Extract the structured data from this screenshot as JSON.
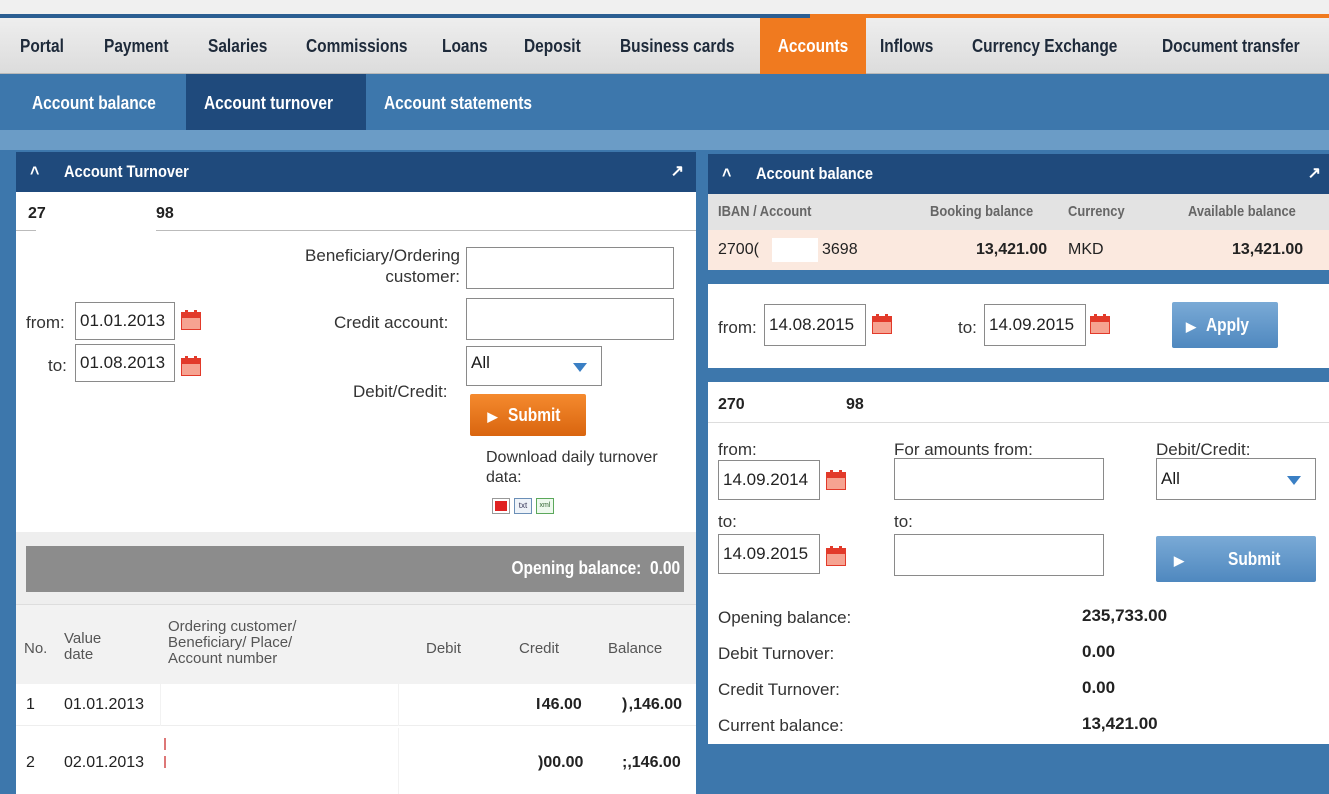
{
  "top_nav": {
    "items": [
      "Portal",
      "Payment",
      "Salaries",
      "Commissions",
      "Loans",
      "Deposit",
      "Business cards",
      "Accounts",
      "Inflows",
      "Currency Exchange",
      "Document transfer"
    ],
    "active": "Accounts"
  },
  "sub_nav": {
    "items": [
      "Account balance",
      "Account turnover",
      "Account statements"
    ],
    "active": "Account turnover"
  },
  "turnover_panel": {
    "title": "Account Turnover",
    "account_part1": "27",
    "account_part2": "98",
    "from_label": "from:",
    "from_value": "01.01.2013",
    "to_label": "to:",
    "to_value": "01.08.2013",
    "beneficiary_label_1": "Beneficiary/Ordering",
    "beneficiary_label_2": "customer:",
    "beneficiary_value": "",
    "credit_account_label": "Credit account:",
    "credit_account_value": "",
    "debit_credit_label": "Debit/Credit:",
    "debit_credit_value": "All",
    "submit_label": "Submit",
    "download_label_1": "Download daily turnover",
    "download_label_2": "data:",
    "download_icons": [
      "pdf-icon",
      "txt-icon",
      "xml-icon"
    ],
    "txt_text": "txt",
    "xml_text": "xml",
    "opening_balance_label": "Opening balance:",
    "opening_balance_value": "0.00",
    "table": {
      "headers": {
        "no": "No.",
        "value_date_1": "Value",
        "value_date_2": "date",
        "ordering_1": "Ordering customer/",
        "ordering_2": "Beneficiary/ Place/",
        "ordering_3": "Account number",
        "debit": "Debit",
        "credit": "Credit",
        "balance": "Balance"
      },
      "rows": [
        {
          "no": "1",
          "date": "01.01.2013",
          "credit": "І 46.00",
          "balance": ") ,146.00"
        },
        {
          "no": "2",
          "date": "02.01.2013",
          "credit": ")00.00",
          "balance": ";,146.00"
        }
      ]
    }
  },
  "balance_panel": {
    "title": "Account balance",
    "headers": {
      "iban": "IBAN / Account",
      "booking": "Booking balance",
      "currency": "Currency",
      "available": "Available balance"
    },
    "row": {
      "iban_part1": "2700(",
      "iban_part2": "3698",
      "booking": "13,421.00",
      "currency": "MKD",
      "available": "13,421.00"
    },
    "from_label": "from:",
    "from_value": "14.08.2015",
    "to_label": "to:",
    "to_value": "14.09.2015",
    "apply_label": "Apply"
  },
  "detail_panel": {
    "account_part1": "270",
    "account_part2": "98",
    "from_label": "from:",
    "from_value": "14.09.2014",
    "to_label": "to:",
    "to_value": "14.09.2015",
    "amounts_from_label": "For amounts from:",
    "amounts_from_value": "",
    "amounts_to_label": "to:",
    "amounts_to_value": "",
    "debit_credit_label": "Debit/Credit:",
    "debit_credit_value": "All",
    "submit_label": "Submit",
    "summary": [
      {
        "label": "Opening balance:",
        "value": "235,733.00"
      },
      {
        "label": "Debit Turnover:",
        "value": "0.00"
      },
      {
        "label": "Credit Turnover:",
        "value": "0.00"
      },
      {
        "label": "Current balance:",
        "value": "13,421.00"
      }
    ]
  },
  "colors": {
    "nav_active": "#f07a1f",
    "panel_header": "#1f4a7c",
    "page_background": "#3d77ac",
    "highlight_row": "#fbe9df"
  }
}
